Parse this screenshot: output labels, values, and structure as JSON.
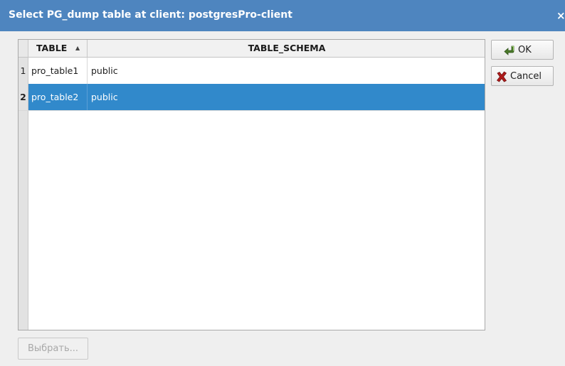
{
  "window": {
    "title": "Select PG_dump table at client: postgresPro-client",
    "close_glyph": "×"
  },
  "table": {
    "columns": [
      {
        "label": "TABLE",
        "sort": "ascending"
      },
      {
        "label": "TABLE_SCHEMA"
      }
    ],
    "sort_glyph": "▲",
    "rows": [
      {
        "num": "1",
        "table": "pro_table1",
        "schema": "public",
        "selected": false
      },
      {
        "num": "2",
        "table": "pro_table2",
        "schema": "public",
        "selected": true
      }
    ]
  },
  "buttons": {
    "ok": {
      "label": "OK",
      "icon": "ok-arrow-icon"
    },
    "cancel": {
      "label": "Cancel",
      "icon": "cancel-x-icon"
    },
    "choose": {
      "label": "Выбрать...",
      "enabled": false
    }
  },
  "colors": {
    "titlebar": "#4e85bf",
    "selection": "#3189cb",
    "cancel_icon": "#b01c1c",
    "ok_icon": "#4a7a2a"
  }
}
